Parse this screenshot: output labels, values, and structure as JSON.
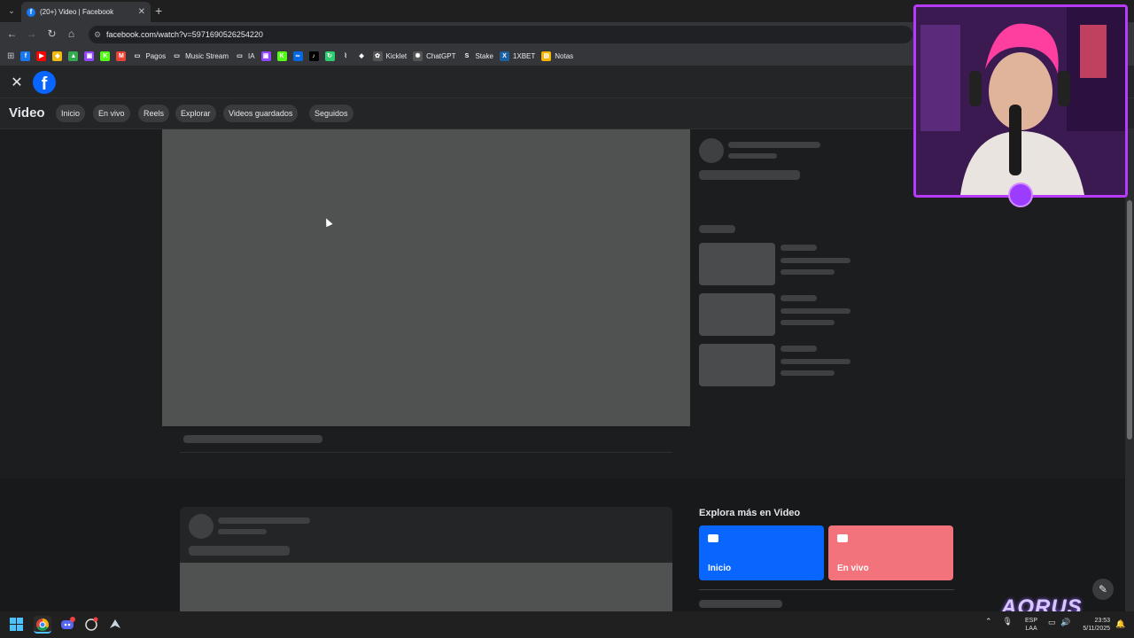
{
  "browser": {
    "tab_title": "(20+) Video | Facebook",
    "url": "facebook.com/watch?v=5971690526254220",
    "bookmarks": [
      {
        "label": "",
        "icon": "facebook-icon",
        "color": "#1877f2",
        "glyph": "f"
      },
      {
        "label": "",
        "icon": "youtube-icon",
        "color": "#ff0000",
        "glyph": "▶"
      },
      {
        "label": "",
        "icon": "binance-icon",
        "color": "#f0b90b",
        "glyph": "◆"
      },
      {
        "label": "",
        "icon": "drive-icon",
        "color": "#34a853",
        "glyph": "▲"
      },
      {
        "label": "",
        "icon": "twitch-icon",
        "color": "#9146ff",
        "glyph": "▣"
      },
      {
        "label": "",
        "icon": "kick-icon",
        "color": "#53fc18",
        "glyph": "K"
      },
      {
        "label": "",
        "icon": "gmail-icon",
        "color": "#ea4335",
        "glyph": "M"
      },
      {
        "label": "Pagos",
        "icon": "folder-icon",
        "color": "#35363a",
        "glyph": "▭"
      },
      {
        "label": "Music Stream",
        "icon": "folder-icon",
        "color": "#35363a",
        "glyph": "▭"
      },
      {
        "label": "IA",
        "icon": "folder-icon",
        "color": "#35363a",
        "glyph": "▭"
      },
      {
        "label": "",
        "icon": "twitch-icon",
        "color": "#9146ff",
        "glyph": "▣"
      },
      {
        "label": "",
        "icon": "kick-icon",
        "color": "#53fc18",
        "glyph": "K"
      },
      {
        "label": "",
        "icon": "meta-icon",
        "color": "#0668e1",
        "glyph": "∞"
      },
      {
        "label": "",
        "icon": "tiktok-icon",
        "color": "#000000",
        "glyph": "♪"
      },
      {
        "label": "",
        "icon": "refresh-app-icon",
        "color": "#2ecc71",
        "glyph": "↻"
      },
      {
        "label": "",
        "icon": "tool-icon",
        "color": "#35363a",
        "glyph": "⌇"
      },
      {
        "label": "",
        "icon": "diamond-icon",
        "color": "#35363a",
        "glyph": "◆"
      },
      {
        "label": "Kicklet",
        "icon": "kicklet-icon",
        "color": "#555555",
        "glyph": "✿"
      },
      {
        "label": "ChatGPT",
        "icon": "chatgpt-icon",
        "color": "#555555",
        "glyph": "✺"
      },
      {
        "label": "Stake",
        "icon": "stake-icon",
        "color": "#35363a",
        "glyph": "S"
      },
      {
        "label": "1XBET",
        "icon": "1xbet-icon",
        "color": "#1a5fa0",
        "glyph": "X"
      },
      {
        "label": "Notas",
        "icon": "notes-icon",
        "color": "#f4b400",
        "glyph": "▤"
      }
    ]
  },
  "facebook": {
    "section_title": "Video",
    "subnav": [
      "Inicio",
      "En vivo",
      "Reels",
      "Explorar",
      "Videos guardados",
      "Seguidos"
    ],
    "explore": {
      "title": "Explora más en Video",
      "cards": [
        {
          "label": "Inicio",
          "color": "#0866ff"
        },
        {
          "label": "En vivo",
          "color": "#f2737b"
        }
      ]
    }
  },
  "overlay": {
    "brand": "AORUS"
  },
  "taskbar": {
    "lang_line1": "ESP",
    "lang_line2": "LAA",
    "time": "23:53",
    "date": "5/11/2025"
  }
}
